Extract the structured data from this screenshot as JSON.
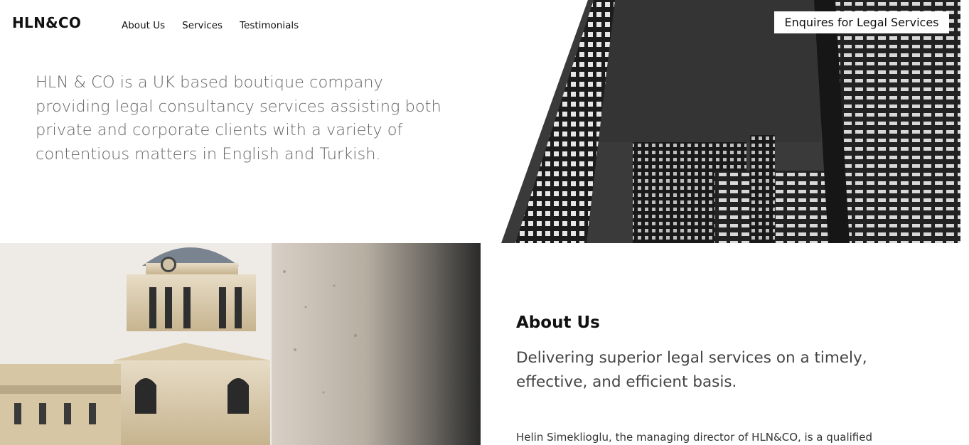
{
  "header": {
    "logo": "HLN&CO",
    "nav": [
      "About Us",
      "Services",
      "Testimonials"
    ],
    "cta": "Enquires for Legal Services"
  },
  "intro": {
    "text": "HLN & CO is a UK based boutique company providing legal consultancy services assisting both private and corporate clients with a variety of contentious matters in English and Turkish."
  },
  "about": {
    "title": "About Us",
    "subtitle": "Delivering superior legal services on a timely, effective, and efficient basis.",
    "body": "Helin Simeklioglu, the managing director of HLN&CO, is a qualified"
  },
  "images": {
    "hero": "night-city-skyscrapers-image",
    "photo": "old-royal-naval-college-dome-image"
  }
}
